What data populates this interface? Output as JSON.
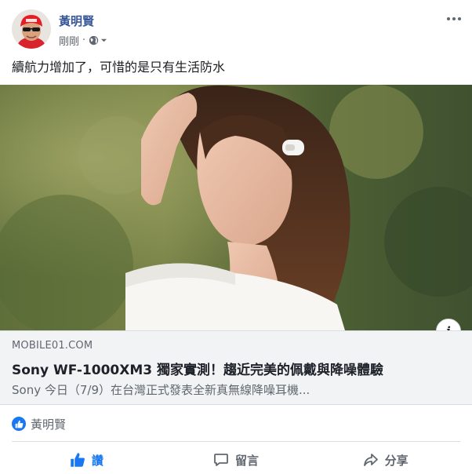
{
  "post": {
    "author": "黃明賢",
    "timestamp": "剛剛",
    "separator": "·",
    "audience_icon": "globe-icon",
    "text": "續航力增加了，可惜的是只有生活防水",
    "more_icon": "more-options-icon"
  },
  "link": {
    "domain": "MOBILE01.COM",
    "title": "Sony WF-1000XM3 獨家實測！趨近完美的佩戴與降噪體驗",
    "description": "Sony 今日（7/9）在台灣正式發表全新真無線降噪耳機...",
    "info_icon_label": "i"
  },
  "reactions": {
    "icon": "like-icon",
    "names": "黃明賢"
  },
  "actions": [
    {
      "label": "讚",
      "icon": "thumbs-up-icon",
      "active": true
    },
    {
      "label": "留言",
      "icon": "comment-icon",
      "active": false
    },
    {
      "label": "分享",
      "icon": "share-icon",
      "active": false
    }
  ],
  "colors": {
    "accent": "#1877f2",
    "author_link": "#385898",
    "secondary_text": "#606770",
    "link_box_bg": "#f2f3f5"
  }
}
